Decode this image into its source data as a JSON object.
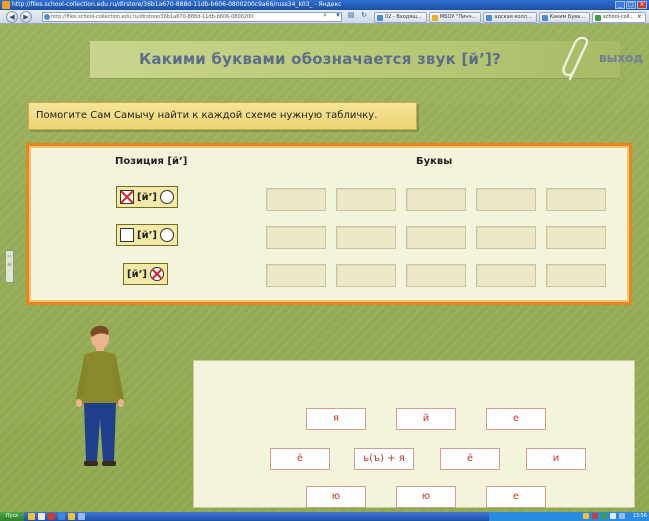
{
  "browser": {
    "title": "http://files.school-collection.edu.ru/dlrstore/36b1a670-888d-11db-b606-0800200c9a66/russ34_k03_ - Яндекс",
    "address": "http://files.school-collection.edu.ru/dlrstore/36b1a670-888d-11db-b606-0800200",
    "tabs": [
      {
        "label": "02 - Входящ...",
        "color": "#4a8ad8"
      },
      {
        "label": "МБОУ \"Пинч...",
        "color": "#e8b020"
      },
      {
        "label": "адская колл...",
        "color": "#4a8ad8"
      },
      {
        "label": "Каким Бува...",
        "color": "#4a8ad8"
      },
      {
        "label": "school-coll...",
        "color": "#3aa040"
      }
    ]
  },
  "page": {
    "title": "Какими буквами обозначается звук [й’]?",
    "exit_label": "выход",
    "instruction": "Помогите Сам Самычу найти к каждой схеме нужную табличку."
  },
  "task": {
    "col_position": "Позиция [й’]",
    "col_letters": "Буквы",
    "schemes": [
      {
        "phoneme": "[й’]",
        "left_box": true,
        "left_crossed": true,
        "right_circle": true,
        "right_crossed": false
      },
      {
        "phoneme": "[й’]",
        "left_box": true,
        "left_crossed": false,
        "right_circle": true,
        "right_crossed": false
      },
      {
        "phoneme": "[й’]",
        "left_box": false,
        "left_crossed": false,
        "right_circle": true,
        "right_crossed": true
      }
    ]
  },
  "cards": [
    "я",
    "й",
    "е",
    "ё",
    "ь(ъ) + я",
    "ё",
    "и",
    "ю",
    "ю",
    "е"
  ],
  "taskbar": {
    "start_label": "Пуск",
    "clock": "13:56"
  },
  "colors": {
    "accent_orange": "#e8861e",
    "card_text": "#c53a2a",
    "title_text": "#5c6e8a"
  }
}
